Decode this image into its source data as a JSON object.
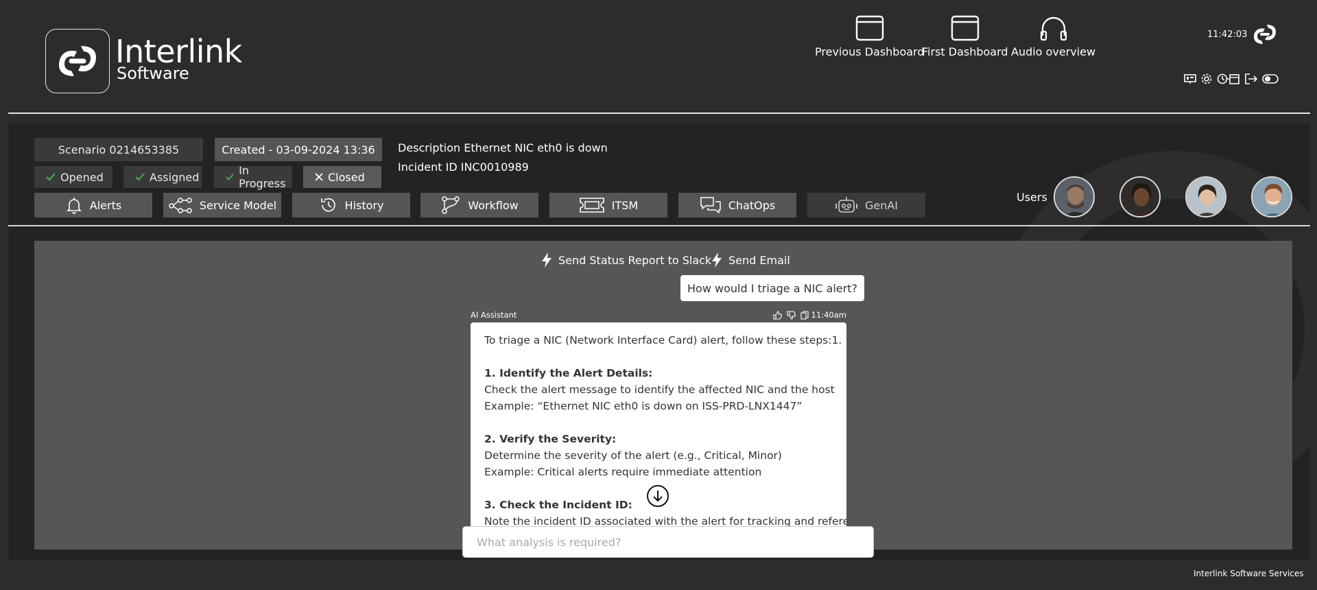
{
  "brand": {
    "name": "Interlink",
    "sub": "Software"
  },
  "nav": [
    {
      "label": "Previous Dashboard",
      "icon": "window-icon"
    },
    {
      "label": "First Dashboard",
      "icon": "window-icon"
    },
    {
      "label": "Audio overview",
      "icon": "headphones-icon"
    }
  ],
  "clock": "11:42:03",
  "incident": {
    "scenario": "Scenario 0214653385",
    "created": "Created - 03-09-2024 13:36",
    "description": "Description Ethernet NIC eth0 is down",
    "incident_id": "Incident ID INC0010989"
  },
  "statuses": {
    "opened": "Opened",
    "assigned": "Assigned",
    "in_progress": "In Progress",
    "closed": "Closed"
  },
  "tabs": {
    "alerts": "Alerts",
    "service_model": "Service Model",
    "history": "History",
    "workflow": "Workflow",
    "itsm": "ITSM",
    "chatops": "ChatOps",
    "genai": "GenAI"
  },
  "users_label": "Users",
  "actions": {
    "slack": "Send Status Report to Slack",
    "email": "Send Email"
  },
  "chat": {
    "user_message": "How would I triage a NIC alert?",
    "assistant_name": "AI Assistant",
    "assistant_time": "11:40am",
    "response": {
      "intro": "To triage a NIC (Network Interface Card) alert, follow these steps:1.",
      "s1_title": "1. Identify the Alert Details:",
      "s1_l1": "Check the alert message to identify the affected NIC and the host",
      "s1_l2": "Example: “Ethernet NIC eth0 is down on ISS-PRD-LNX1447”",
      "s2_title": "2. Verify the Severity:",
      "s2_l1": "Determine the severity of the alert (e.g., Critical, Minor)",
      "s2_l2": "Example: Critical alerts require immediate attention",
      "s3_title": "3. Check the Incident ID:",
      "s3_l1": "Note the incident ID associated with the alert for tracking and reference."
    },
    "input_placeholder": "What analysis is required?"
  },
  "footer": "Interlink Software Services",
  "colors": {
    "background": "#2c2c2c",
    "panel": "#232323",
    "chat_area": "#565656",
    "check": "#4caf50"
  }
}
